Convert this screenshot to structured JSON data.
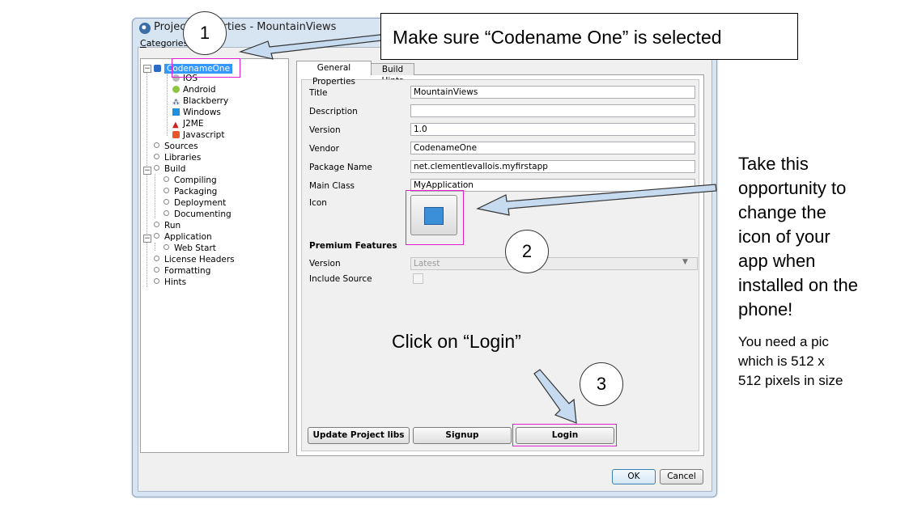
{
  "dialog": {
    "title": "Project Properties - MountainViews",
    "categories_label_underlined": "C",
    "categories_label_rest": "ategories:",
    "ok_label": "OK",
    "cancel_label": "Cancel"
  },
  "tree": {
    "items": [
      {
        "label": "CodenameOne",
        "selected": true
      },
      {
        "label": "IOS"
      },
      {
        "label": "Android"
      },
      {
        "label": "Blackberry"
      },
      {
        "label": "Windows"
      },
      {
        "label": "J2ME"
      },
      {
        "label": "Javascript"
      },
      {
        "label": "Sources"
      },
      {
        "label": "Libraries"
      },
      {
        "label": "Build"
      },
      {
        "label": "Compiling"
      },
      {
        "label": "Packaging"
      },
      {
        "label": "Deployment"
      },
      {
        "label": "Documenting"
      },
      {
        "label": "Run"
      },
      {
        "label": "Application"
      },
      {
        "label": "Web Start"
      },
      {
        "label": "License Headers"
      },
      {
        "label": "Formatting"
      },
      {
        "label": "Hints"
      }
    ]
  },
  "tabs": {
    "general": "General Properties",
    "build_hints": "Build Hints"
  },
  "form": {
    "title_label": "Title",
    "title_value": "MountainViews",
    "description_label": "Description",
    "description_value": "",
    "version_label": "Version",
    "version_value": "1.0",
    "vendor_label": "Vendor",
    "vendor_value": "CodenameOne",
    "package_label": "Package Name",
    "package_value": "net.clementlevallois.myfirstapp",
    "mainclass_label": "Main Class",
    "mainclass_value": "MyApplication",
    "icon_label": "Icon",
    "premium_heading": "Premium Features",
    "premium_version_label": "Version",
    "premium_version_value": "Latest",
    "include_source_label": "Include Source"
  },
  "buttons": {
    "update": "Update Project libs",
    "signup": "Signup",
    "login": "Login"
  },
  "annotations": {
    "step1": "1",
    "step2": "2",
    "step3": "3",
    "callout_top": "Make sure “Codename One” is selected",
    "icon_note_lines": [
      "Take this",
      "opportunity to",
      "change the",
      "icon of your",
      "app when",
      "installed on the",
      "phone!"
    ],
    "pic_note_lines": [
      "You need a pic",
      "which is 512 x",
      "512 pixels in size"
    ],
    "click_login": "Click on “Login”"
  },
  "colors": {
    "highlight_box": "#e020d0",
    "selection": "#3399ff",
    "arrow_fill": "#c6daf0"
  }
}
